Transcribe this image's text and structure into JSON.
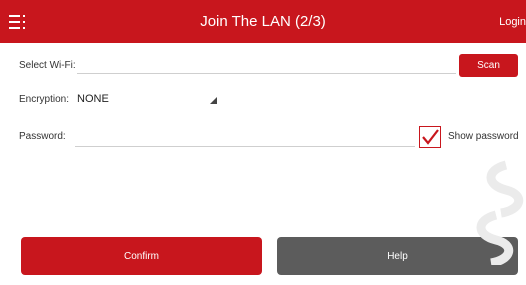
{
  "header": {
    "title": "Join The LAN (2/3)",
    "login_label": "Login"
  },
  "form": {
    "wifi_label": "Select Wi-Fi:",
    "wifi_value": "",
    "scan_label": "Scan",
    "encryption_label": "Encryption:",
    "encryption_value": "NONE",
    "password_label": "Password:",
    "password_value": "",
    "show_password_label": "Show password",
    "show_password_checked": true
  },
  "buttons": {
    "confirm_label": "Confirm",
    "help_label": "Help"
  },
  "colors": {
    "brand": "#c8161d",
    "help_button": "#5c5c5c"
  }
}
